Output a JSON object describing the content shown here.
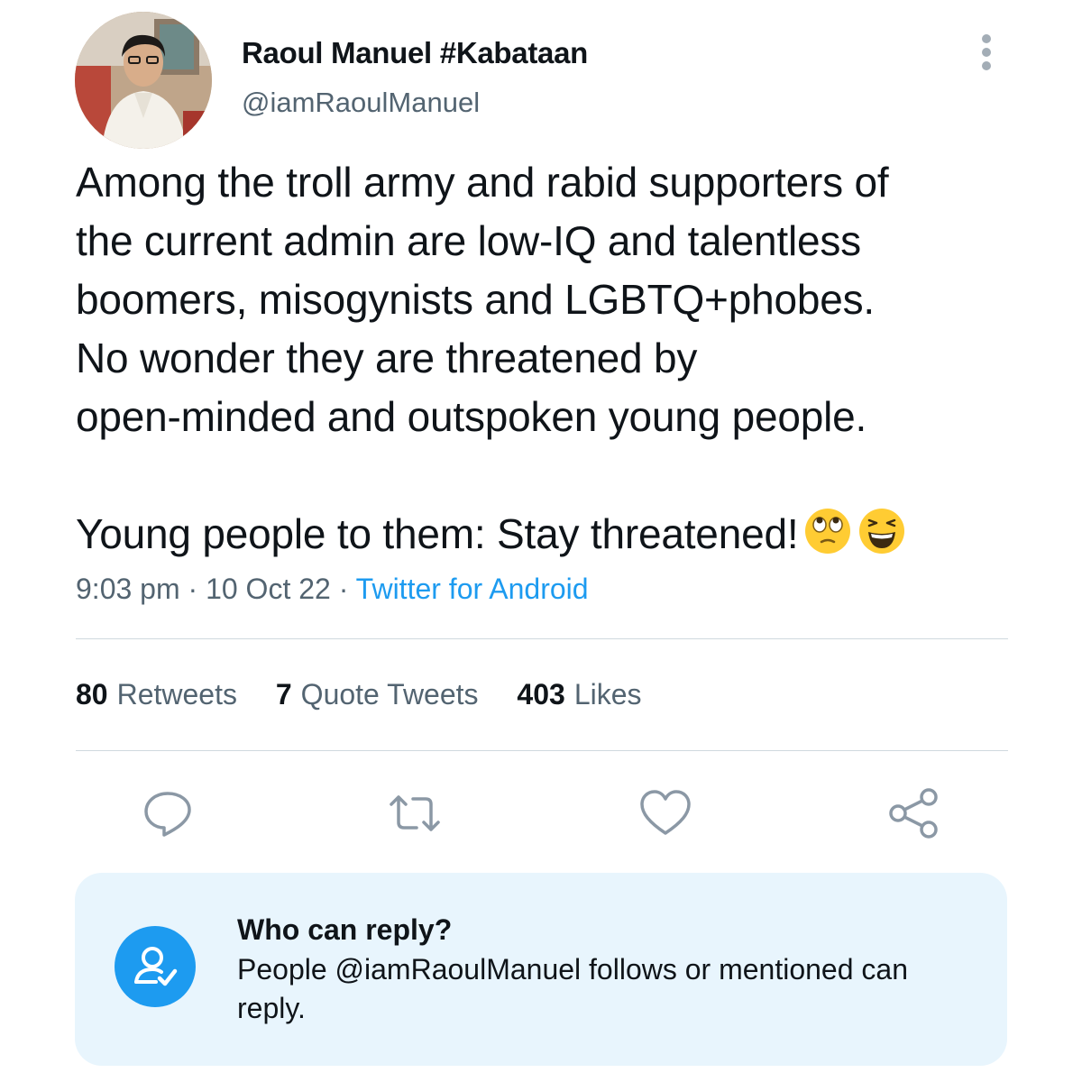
{
  "author": {
    "display_name": "Raoul Manuel #Kabataan",
    "handle": "@iamRaoulManuel"
  },
  "tweet": {
    "lines": [
      "Among the troll army and rabid supporters of",
      "the current admin are low-IQ and talentless",
      "boomers, misogynists and LGBTQ+phobes.",
      "No wonder they are threatened by",
      "open-minded and outspoken young people."
    ],
    "second_paragraph": "Young people to them: Stay threatened!",
    "emojis": [
      "face-with-rolling-eyes-emoji",
      "grinning-squinting-face-emoji"
    ]
  },
  "meta": {
    "time": "9:03 pm",
    "separator1": " · ",
    "date": "10 Oct 22",
    "separator2": " · ",
    "source": "Twitter for Android"
  },
  "stats": {
    "retweets_count": "80",
    "retweets_label": "Retweets",
    "quotes_count": "7",
    "quotes_label": "Quote Tweets",
    "likes_count": "403",
    "likes_label": "Likes"
  },
  "actions": {
    "reply_icon": "speech-bubble-icon",
    "retweet_icon": "retweet-icon",
    "like_icon": "heart-icon",
    "share_icon": "share-nodes-icon"
  },
  "reply_restriction": {
    "title": "Who can reply?",
    "description": "People @iamRaoulManuel follows or mentioned can reply.",
    "icon": "user-check-icon"
  },
  "colors": {
    "accent": "#1d9bf0",
    "secondary_text": "#536471",
    "card_background": "#e8f5fd"
  }
}
